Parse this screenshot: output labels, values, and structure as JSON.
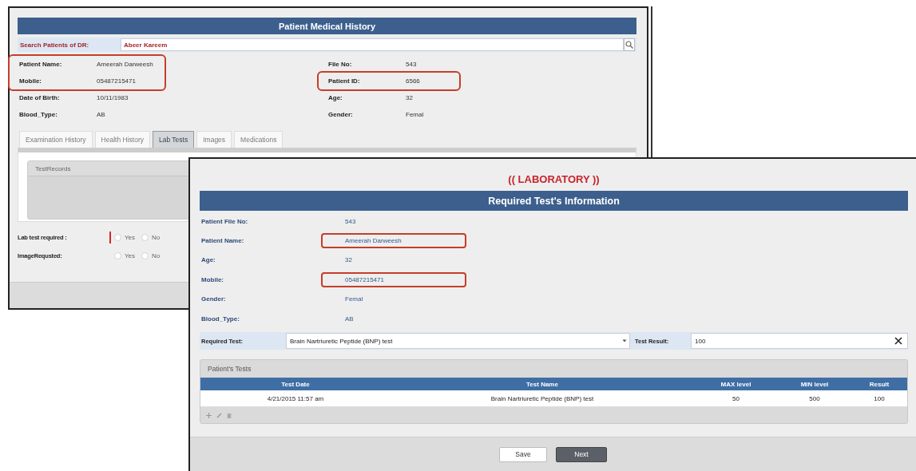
{
  "history_window": {
    "title": "Patient Medical History",
    "search": {
      "label": "Search Patients of DR:",
      "value": "Abeer Kareem"
    },
    "left_fields": [
      {
        "label": "Patient Name:",
        "value": "Ameerah Darweesh",
        "highlighted": true
      },
      {
        "label": "Mobile:",
        "value": "05487215471",
        "highlighted": true
      },
      {
        "label": "Date of Birth:",
        "value": "10/11/1983",
        "highlighted": false
      },
      {
        "label": "Blood_Type:",
        "value": "AB",
        "highlighted": false
      }
    ],
    "right_fields": [
      {
        "label": "File No:",
        "value": "543",
        "highlighted": false
      },
      {
        "label": "Patient ID:",
        "value": "6566",
        "highlighted": true
      },
      {
        "label": "Age:",
        "value": "32",
        "highlighted": false
      },
      {
        "label": "Gender:",
        "value": "Femal",
        "highlighted": false
      }
    ],
    "tabs": [
      {
        "label": "Examination History",
        "selected": false
      },
      {
        "label": "Health History",
        "selected": false
      },
      {
        "label": "Lab Tests",
        "selected": true
      },
      {
        "label": "Images",
        "selected": false
      },
      {
        "label": "Medications",
        "selected": false
      }
    ],
    "grid": {
      "title": "TestRecords"
    },
    "questions": [
      {
        "label": "Lab test required :",
        "invalid": true,
        "options": [
          {
            "label": "Yes",
            "selected": false
          },
          {
            "label": "No",
            "selected": false
          }
        ]
      },
      {
        "label": "ImageRequsted:",
        "invalid": false,
        "options": [
          {
            "label": "Yes",
            "selected": false
          },
          {
            "label": "No",
            "selected": false
          }
        ]
      }
    ]
  },
  "lab_window": {
    "heading": "(( LABORATORY ))",
    "title": "Required Test's Information",
    "fields": [
      {
        "label": "Patient File No:",
        "value": "543",
        "highlighted": false
      },
      {
        "label": "Patient Name:",
        "value": "Ameerah Darweesh",
        "highlighted": true
      },
      {
        "label": "Age:",
        "value": "32",
        "highlighted": false
      },
      {
        "label": "Mobile:",
        "value": "05487215471",
        "highlighted": true
      },
      {
        "label": "Gender:",
        "value": "Femal",
        "highlighted": false
      },
      {
        "label": "Blood_Type:",
        "value": "AB",
        "highlighted": false
      }
    ],
    "required_test": {
      "label": "Required Test:",
      "value": "Brain Nartriuretic Peptide (BNP) test"
    },
    "test_result": {
      "label": "Test Result:",
      "value": "100"
    },
    "tests_grid": {
      "title": "Patient's Tests",
      "columns": [
        "Test Date",
        "Test Name",
        "MAX level",
        "MIN level",
        "Result"
      ],
      "rows": [
        [
          "4/21/2015 11:57 am",
          "Brain Nartriuretic Peptide (BNP) test",
          "50",
          "500",
          "100"
        ]
      ]
    },
    "buttons": [
      {
        "label": "Save",
        "kind": "secondary"
      },
      {
        "label": "Next",
        "kind": "primary"
      }
    ]
  }
}
